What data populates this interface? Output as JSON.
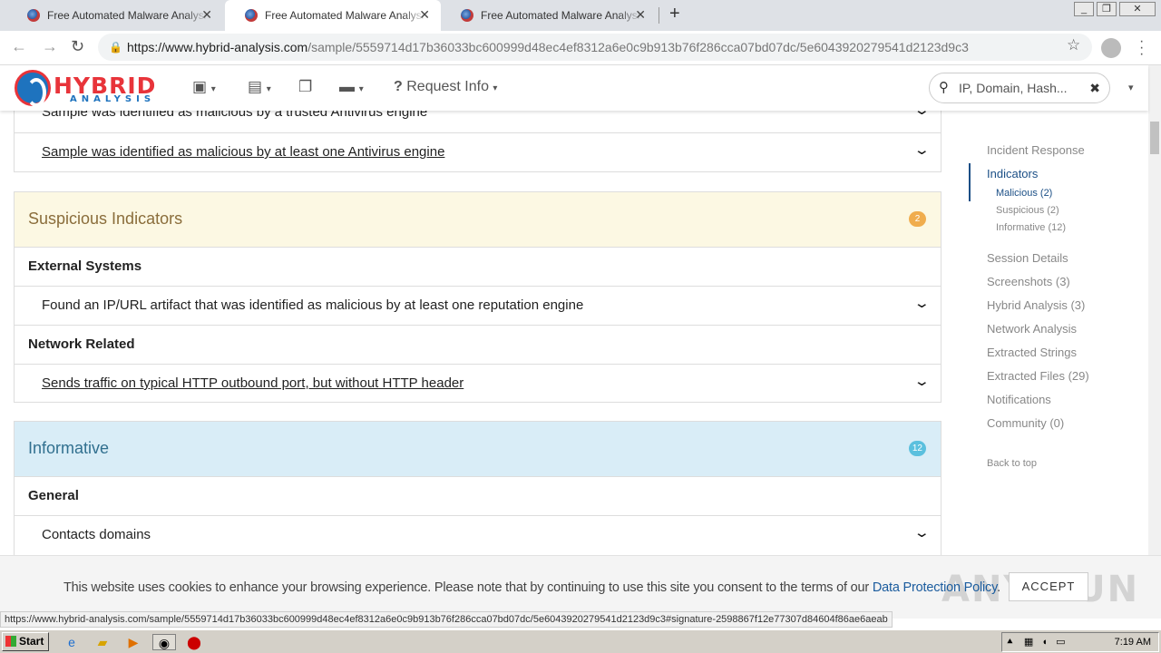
{
  "browser": {
    "tabs": [
      {
        "title": "Free Automated Malware Analysis Se"
      },
      {
        "title": "Free Automated Malware Analysis Se"
      },
      {
        "title": "Free Automated Malware Analysis Se"
      }
    ],
    "new_tab": "+",
    "url_host": "https://www.hybrid-analysis.com",
    "url_path": "/sample/5559714d17b36033bc600999d48ec4ef8312a6e0c9b913b76f286cca07bd07dc/5e6043920279541d2123d9c3",
    "status_url": "https://www.hybrid-analysis.com/sample/5559714d17b36033bc600999d48ec4ef8312a6e0c9b913b76f286cca07bd07dc/5e6043920279541d2123d9c3#signature-2598867f12e77307d84604f86ae6aeab"
  },
  "site": {
    "logo_word1": "HYBRID",
    "logo_word2": "ANALYSIS",
    "request_info": "Request Info",
    "search_placeholder": "IP, Domain, Hash..."
  },
  "malicious_rows": [
    {
      "text": "Sample was identified as malicious by a trusted Antivirus engine"
    },
    {
      "text": "Sample was identified as malicious by at least one Antivirus engine"
    }
  ],
  "suspicious": {
    "title": "Suspicious Indicators",
    "count": "2",
    "color": "#f0ad4e",
    "bg": "#fcf8e3",
    "cat1": "External Systems",
    "row1": "Found an IP/URL artifact that was identified as malicious by at least one reputation engine",
    "cat2": "Network Related",
    "row2": "Sends traffic on typical HTTP outbound port, but without HTTP header"
  },
  "informative": {
    "title": "Informative",
    "count": "12",
    "color": "#5bc0de",
    "bg": "#d9edf7",
    "cat1": "General",
    "row1": "Contacts domains"
  },
  "sidebar": {
    "incident_response": "Incident Response",
    "indicators": "Indicators",
    "malicious": "Malicious (2)",
    "suspicious": "Suspicious (2)",
    "informative": "Informative (12)",
    "session_details": "Session Details",
    "screenshots": "Screenshots (3)",
    "hybrid_analysis": "Hybrid Analysis (3)",
    "network_analysis": "Network Analysis",
    "extracted_strings": "Extracted Strings",
    "extracted_files": "Extracted Files (29)",
    "notifications": "Notifications",
    "community": "Community (0)",
    "back_to_top": "Back to top"
  },
  "cookie": {
    "text": "This website uses cookies to enhance your browsing experience. Please note that by continuing to use this site you consent to the terms of our ",
    "link": "Data Protection Policy",
    "period": ".",
    "accept": "ACCEPT",
    "watermark": "ANY RUN"
  },
  "taskbar": {
    "start": "Start",
    "clock": "7:19 AM"
  }
}
